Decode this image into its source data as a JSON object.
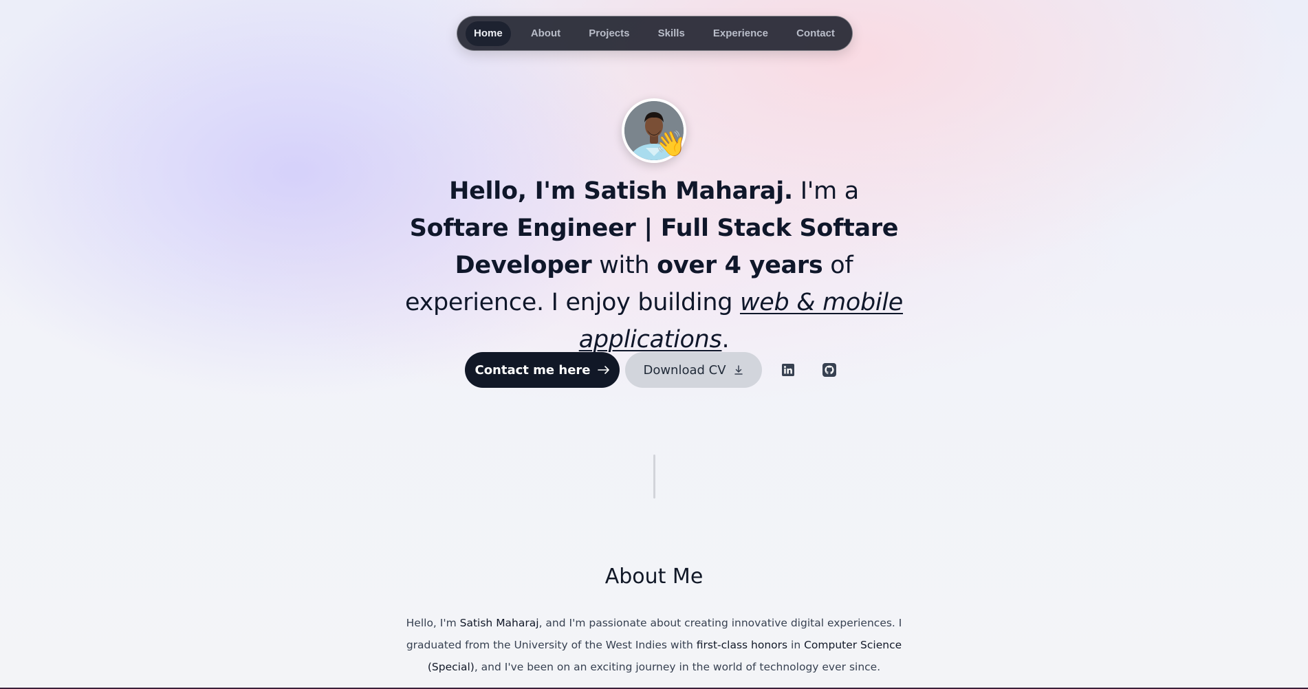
{
  "nav": {
    "items": [
      {
        "label": "Home",
        "active": true
      },
      {
        "label": "About",
        "active": false
      },
      {
        "label": "Projects",
        "active": false
      },
      {
        "label": "Skills",
        "active": false
      },
      {
        "label": "Experience",
        "active": false
      },
      {
        "label": "Contact",
        "active": false
      }
    ]
  },
  "hero": {
    "avatar_icon": "person-photo",
    "wave_emoji": "👋",
    "headline": {
      "greeting": "Hello, I'm Satish Maharaj.",
      "im_a": " I'm a ",
      "role": "Softare Engineer | Full Stack Softare Developer",
      "with": " with ",
      "years": "over 4 years",
      "of_experience": " of experience. I enjoy building ",
      "focus": "web & mobile applications",
      "end": "."
    },
    "buttons": {
      "contact_label": "Contact me here",
      "contact_icon": "arrow-right-icon",
      "cv_label": "Download CV",
      "cv_icon": "download-icon",
      "linkedin_icon": "linkedin-icon",
      "github_icon": "github-icon"
    }
  },
  "about": {
    "title": "About Me",
    "paragraph": {
      "t1": "Hello, I'm ",
      "name": "Satish Maharaj",
      "t2": ", and I'm passionate about creating innovative digital experiences. I graduated from the University of the West Indies with ",
      "honors": "first-class honors",
      "t3": " in ",
      "degree": "Computer Science (Special)",
      "t4": ", and I've been on an exciting journey in the world of technology ever since."
    }
  },
  "colors": {
    "dark": "#111827",
    "nav_bg": "#262834",
    "cv_button_bg": "#d2d5dc"
  }
}
